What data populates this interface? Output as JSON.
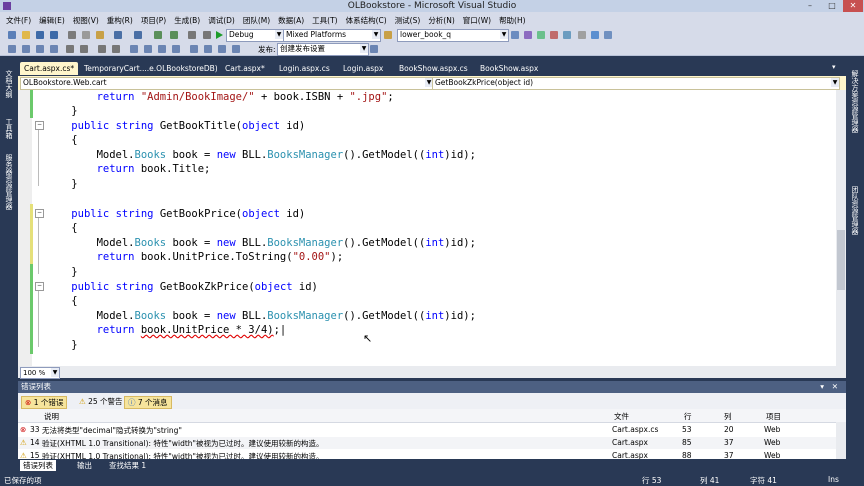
{
  "window": {
    "title": "OLBookstore - Microsoft Visual Studio",
    "minimize": "–",
    "maximize": "□",
    "close": "✕"
  },
  "menu": [
    "文件(F)",
    "编辑(E)",
    "视图(V)",
    "重构(R)",
    "项目(P)",
    "生成(B)",
    "调试(D)",
    "团队(M)",
    "数据(A)",
    "工具(T)",
    "体系结构(C)",
    "测试(S)",
    "分析(N)",
    "窗口(W)",
    "帮助(H)"
  ],
  "toolbar": {
    "config": "Debug",
    "platform": "Mixed Platforms",
    "find": "lower_book_q",
    "publish_label": "发布:",
    "publish_value": "创建发布设置"
  },
  "left_strip": {
    "toolbox": "文档大纲",
    "tools": "工具箱",
    "server": "服务器资源管理器"
  },
  "right_strip": {
    "solution": "解决方案资源管理器",
    "team": "团队资源管理器"
  },
  "doc_tabs": [
    "Cart.aspx.cs*",
    "TemporaryCart....e.OLBookstoreDB)",
    "Cart.aspx*",
    "Login.aspx.cs",
    "Login.aspx",
    "BookShow.aspx.cs",
    "BookShow.aspx"
  ],
  "nav": {
    "class": "OLBookstore.Web.cart",
    "member": "GetBookZkPrice(object id)"
  },
  "zoom": "100 %",
  "error_list": {
    "title": "错误列表",
    "errors_btn": "1 个错误",
    "warnings_btn": "25 个警告",
    "messages_btn": "7 个消息",
    "columns": {
      "desc": "说明",
      "file": "文件",
      "line": "行",
      "col": "列",
      "project": "项目"
    },
    "rows": [
      {
        "num": "33",
        "desc": "无法将类型\"decimal\"隐式转换为\"string\"",
        "file": "Cart.aspx.cs",
        "line": "53",
        "col": "20",
        "project": "Web"
      },
      {
        "num": "14",
        "desc": "验证(XHTML 1.0 Transitional): 特性\"width\"被视为已过时。建议使用较新的构造。",
        "file": "Cart.aspx",
        "line": "85",
        "col": "37",
        "project": "Web"
      },
      {
        "num": "15",
        "desc": "验证(XHTML 1.0 Transitional): 特性\"width\"被视为已过时。建议使用较新的构造。",
        "file": "Cart.aspx",
        "line": "88",
        "col": "37",
        "project": "Web"
      }
    ]
  },
  "bottom_tabs": [
    "错误列表",
    "输出",
    "查找结果 1"
  ],
  "status": {
    "left": "已保存的项",
    "line": "行 53",
    "col": "列 41",
    "char": "字符 41",
    "mode": "Ins"
  },
  "colors": {
    "accent": "#293955",
    "tab_active": "#fff6cc",
    "keyword": "#0000ff",
    "type": "#2b91af",
    "string": "#a31515"
  }
}
